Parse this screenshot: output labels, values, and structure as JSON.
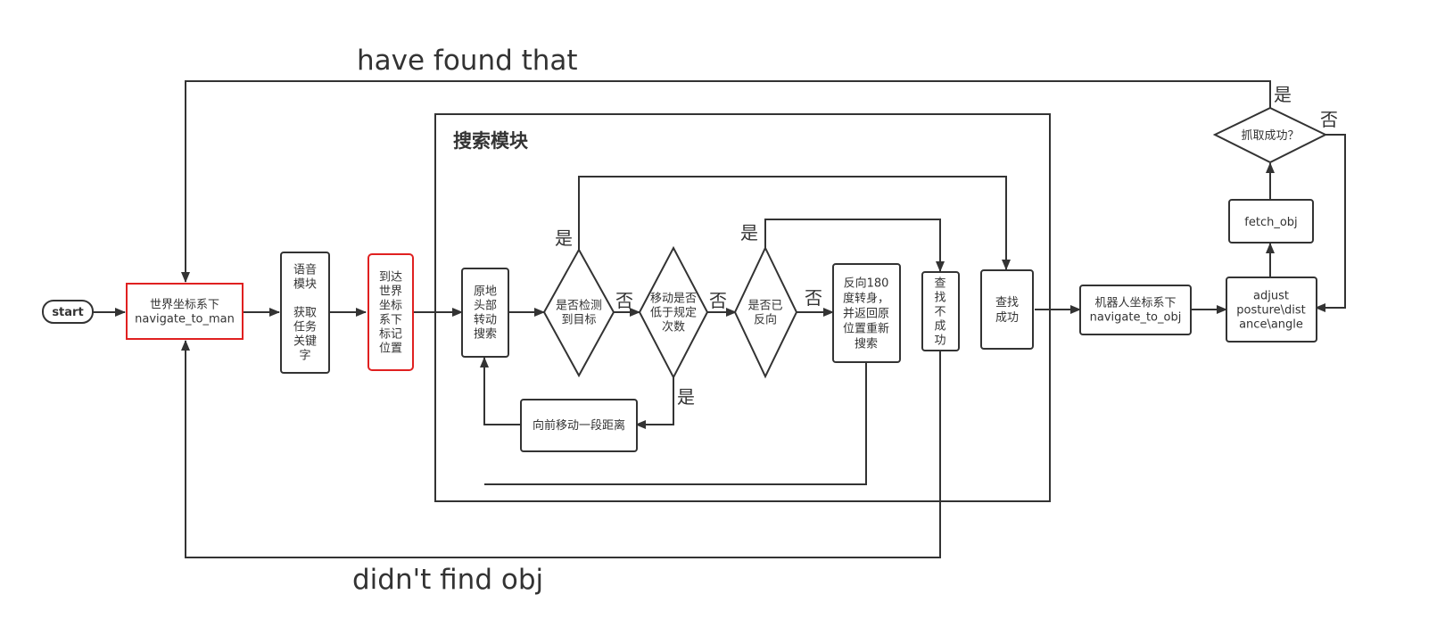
{
  "edge_labels": {
    "found": "have found that",
    "not_found": "didn't find obj",
    "yes": "是",
    "no": "否"
  },
  "module": {
    "title": "搜索模块"
  },
  "nodes": {
    "start": "start",
    "navigate_world": [
      "世界坐标系下",
      "navigate_to_man"
    ],
    "voice": [
      "语音",
      "模块",
      "",
      "获取",
      "任务",
      "关键",
      "字"
    ],
    "arrive": [
      "到达",
      "世界",
      "坐标",
      "系下",
      "标记",
      "位置"
    ],
    "rotate": [
      "原地",
      "头部",
      "转动",
      "搜索"
    ],
    "detect": [
      "是否检测",
      "到目标"
    ],
    "move_check": [
      "移动是否",
      "低于规定",
      "次数"
    ],
    "reversed": [
      "是否已",
      "反向"
    ],
    "reverse_turn": [
      "反向180",
      "度转身，",
      "并返回原",
      "位置重新",
      "搜索"
    ],
    "fail": [
      "查",
      "找",
      "不",
      "成",
      "功"
    ],
    "success": [
      "查找",
      "成功"
    ],
    "move_forward": "向前移动一段距离",
    "navigate_robot": [
      "机器人坐标系下",
      "navigate_to_obj"
    ],
    "adjust": [
      "adjust",
      "posture\\dist",
      "ance\\angle"
    ],
    "fetch": "fetch_obj",
    "grab_ok": "抓取成功？"
  },
  "colors": {
    "stroke": "#333333",
    "highlight": "#e02020"
  }
}
